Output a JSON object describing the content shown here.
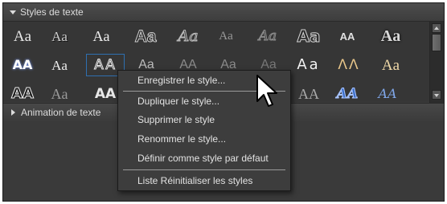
{
  "panel": {
    "section_title": "Styles de texte",
    "animation_title": "Animation de texte"
  },
  "styles": [
    {
      "text": "Aa"
    },
    {
      "text": "Aa"
    },
    {
      "text": "Aa"
    },
    {
      "text": "Aa"
    },
    {
      "text": "Aa"
    },
    {
      "text": "Aa"
    },
    {
      "text": "Aa"
    },
    {
      "text": "Aa"
    },
    {
      "text": "AA"
    },
    {
      "text": "Aa"
    },
    {
      "text": "AA"
    },
    {
      "text": "Aa"
    },
    {
      "text": "AA"
    },
    {
      "text": "Aa"
    },
    {
      "text": "AA"
    },
    {
      "text": "Aa"
    },
    {
      "text": "Aa"
    },
    {
      "text": "Aa"
    },
    {
      "text": "ΛΛ"
    },
    {
      "text": "Aa"
    },
    {
      "text": "AA"
    },
    {
      "text": "Aa"
    },
    {
      "text": "AA"
    },
    {
      "text": "AA"
    },
    {
      "text": "AA"
    },
    {
      "text": "AA"
    },
    {
      "text": "Aa"
    }
  ],
  "context_menu": {
    "items": [
      "Enregistrer le style...",
      "Dupliquer le style...",
      "Supprimer le style",
      "Renommer le style...",
      "Définir comme style par défaut",
      "Liste Réinitialiser les styles"
    ]
  }
}
